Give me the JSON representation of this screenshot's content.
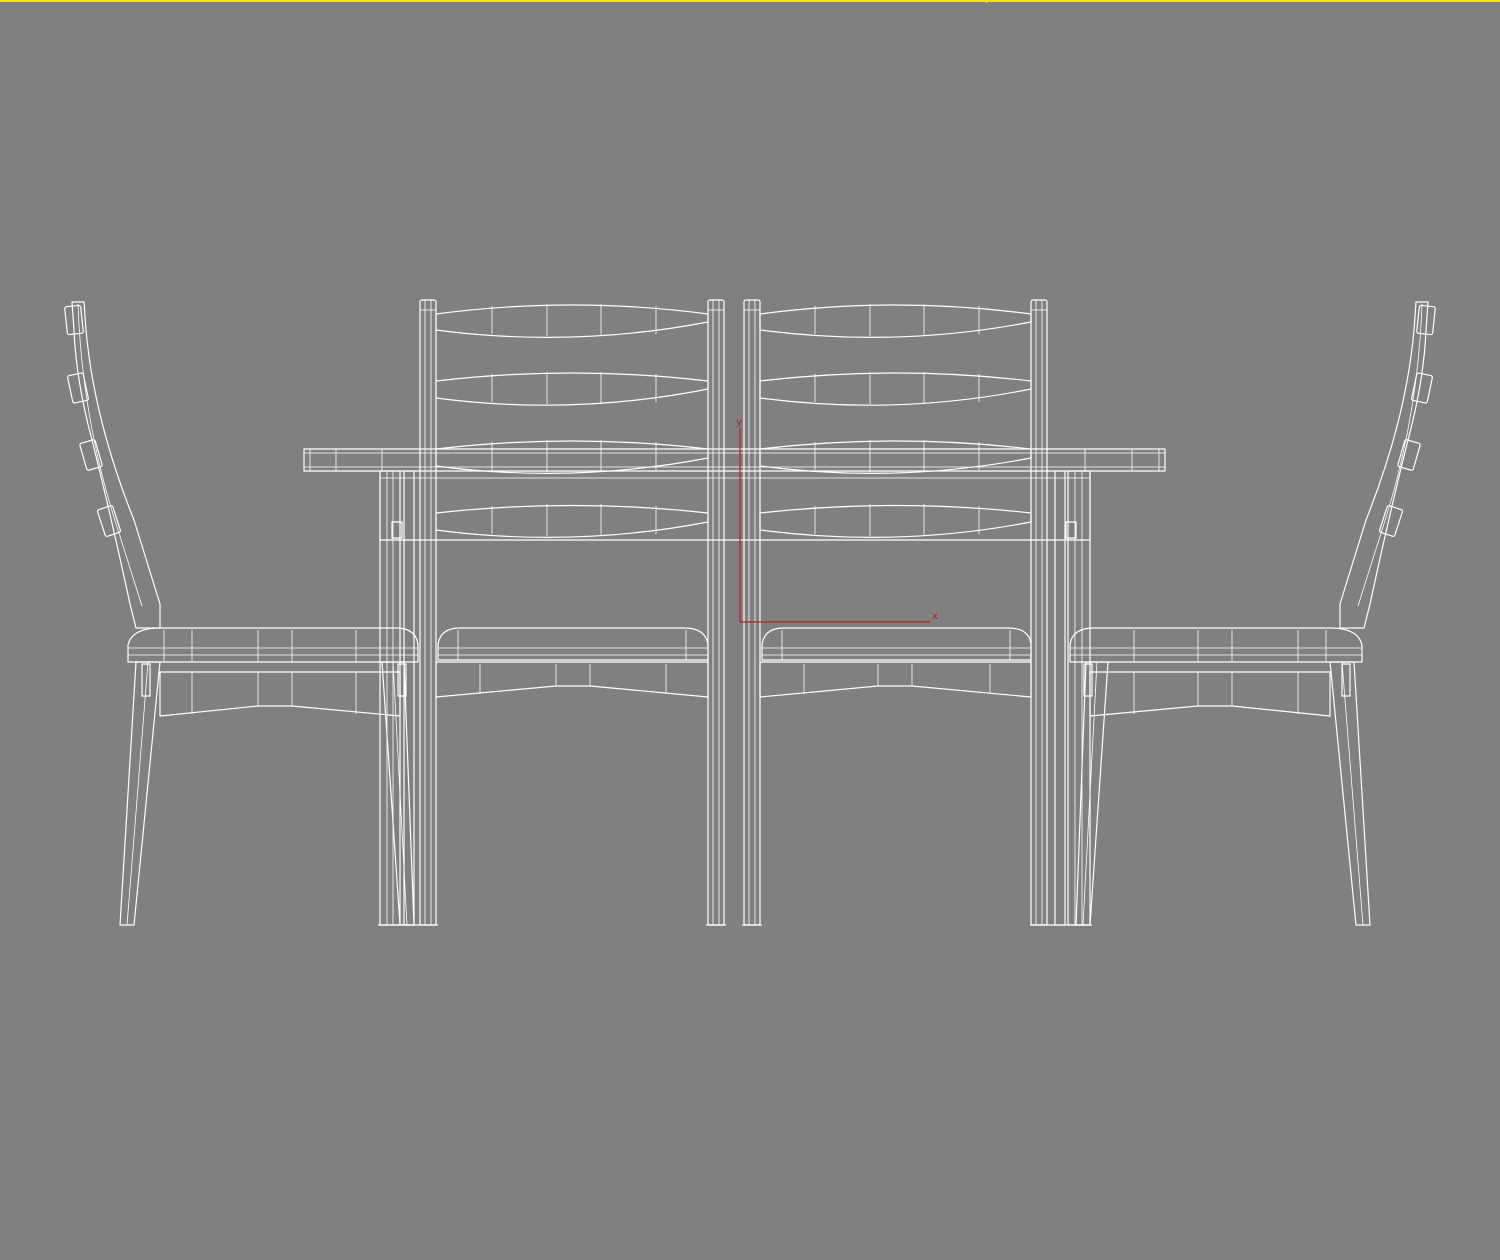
{
  "viewport": {
    "background_color": "#808080",
    "active_border_color": "#f2e600",
    "wire_color": "#ffffff",
    "axis_color": "#b22222"
  },
  "axis_gizmo": {
    "x_label": "x",
    "y_label": "y"
  }
}
